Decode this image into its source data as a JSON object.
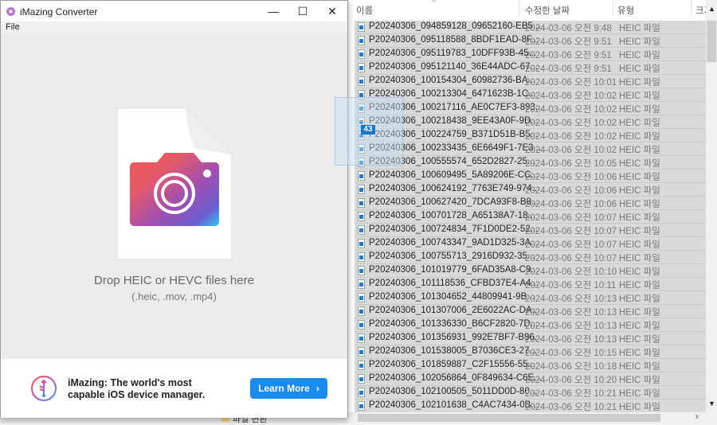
{
  "background": {
    "folder_label": "파일 변환"
  },
  "app": {
    "title": "iMazing Converter",
    "controls": {
      "minimize": "—",
      "maximize": "☐",
      "close": "✕"
    },
    "menu": [
      "File"
    ],
    "drop": {
      "title": "Drop HEIC or HEVC files here",
      "subtitle": "(.heic, .mov, .mp4)"
    },
    "banner": {
      "line1": "iMazing: The world's most",
      "line2": "capable iOS device manager.",
      "button": "Learn More",
      "button_chevron": "›"
    },
    "accent": "#1a8cf0"
  },
  "explorer": {
    "columns": [
      "이름",
      "수정한 날짜",
      "유형",
      "크기"
    ],
    "drag_count": "43",
    "files": [
      {
        "name": "P20240306_094859128_09652160-EB5...",
        "date": "2024-03-06 오전 9:48",
        "type": "HEIC 파일"
      },
      {
        "name": "P20240306_095118588_8BDF1EAD-8F...",
        "date": "2024-03-06 오전 9:51",
        "type": "HEIC 파일"
      },
      {
        "name": "P20240306_095119783_10DFF93B-45...",
        "date": "2024-03-06 오전 9:51",
        "type": "HEIC 파일"
      },
      {
        "name": "P20240306_095121140_36E44ADC-67...",
        "date": "2024-03-06 오전 9:51",
        "type": "HEIC 파일"
      },
      {
        "name": "P20240306_100154304_60982736-BA...",
        "date": "2024-03-06 오전 10:01",
        "type": "HEIC 파일"
      },
      {
        "name": "P20240306_100213304_6471623B-1C...",
        "date": "2024-03-06 오전 10:02",
        "type": "HEIC 파일"
      },
      {
        "name": "P20240306_100217116_AE0C7EF3-893...",
        "date": "2024-03-06 오전 10:02",
        "type": "HEIC 파일"
      },
      {
        "name": "P20240306_100218438_9EE43A0F-9D...",
        "date": "2024-03-06 오전 10:02",
        "type": "HEIC 파일"
      },
      {
        "name": "P20240306_100224759_B371D51B-B5...",
        "date": "2024-03-06 오전 10:02",
        "type": "HEIC 파일"
      },
      {
        "name": "P20240306_100233435_6E6649F1-7E3...",
        "date": "2024-03-06 오전 10:02",
        "type": "HEIC 파일"
      },
      {
        "name": "P20240306_100555574_652D2827-25...",
        "date": "2024-03-06 오전 10:05",
        "type": "HEIC 파일"
      },
      {
        "name": "P20240306_100609495_5A89206E-CC...",
        "date": "2024-03-06 오전 10:06",
        "type": "HEIC 파일"
      },
      {
        "name": "P20240306_100624192_7763E749-974...",
        "date": "2024-03-06 오전 10:06",
        "type": "HEIC 파일"
      },
      {
        "name": "P20240306_100627420_7DCA93F8-B8...",
        "date": "2024-03-06 오전 10:06",
        "type": "HEIC 파일"
      },
      {
        "name": "P20240306_100701728_A65138A7-18...",
        "date": "2024-03-06 오전 10:07",
        "type": "HEIC 파일"
      },
      {
        "name": "P20240306_100724834_7F1D0DE2-52...",
        "date": "2024-03-06 오전 10:07",
        "type": "HEIC 파일"
      },
      {
        "name": "P20240306_100743347_9AD1D325-3A...",
        "date": "2024-03-06 오전 10:07",
        "type": "HEIC 파일"
      },
      {
        "name": "P20240306_100755713_2916D932-35...",
        "date": "2024-03-06 오전 10:07",
        "type": "HEIC 파일"
      },
      {
        "name": "P20240306_101019779_6FAD35A8-C9...",
        "date": "2024-03-06 오전 10:10",
        "type": "HEIC 파일"
      },
      {
        "name": "P20240306_101118536_CFBD37E4-A4...",
        "date": "2024-03-06 오전 10:11",
        "type": "HEIC 파일"
      },
      {
        "name": "P20240306_101304652_44809941-9B...",
        "date": "2024-03-06 오전 10:13",
        "type": "HEIC 파일"
      },
      {
        "name": "P20240306_101307006_2E6022AC-DA...",
        "date": "2024-03-06 오전 10:13",
        "type": "HEIC 파일"
      },
      {
        "name": "P20240306_101336330_B6CF2820-7D...",
        "date": "2024-03-06 오전 10:13",
        "type": "HEIC 파일"
      },
      {
        "name": "P20240306_101356931_992E7BF7-B96...",
        "date": "2024-03-06 오전 10:13",
        "type": "HEIC 파일"
      },
      {
        "name": "P20240306_101538005_B7036CE3-27...",
        "date": "2024-03-06 오전 10:15",
        "type": "HEIC 파일"
      },
      {
        "name": "P20240306_101859887_C2F15556-55...",
        "date": "2024-03-06 오전 10:18",
        "type": "HEIC 파일"
      },
      {
        "name": "P20240306_102056864_0F849634-C6E...",
        "date": "2024-03-06 오전 10:20",
        "type": "HEIC 파일"
      },
      {
        "name": "P20240306_102100505_5011DD0D-80...",
        "date": "2024-03-06 오전 10:21",
        "type": "HEIC 파일"
      },
      {
        "name": "P20240306_102101638_C4AC7434-0B...",
        "date": "2024-03-06 오전 10:21",
        "type": "HEIC 파일"
      }
    ]
  }
}
